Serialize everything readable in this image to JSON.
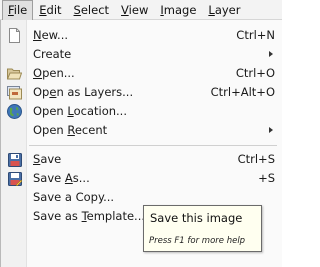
{
  "menubar": {
    "items": [
      {
        "id": "file",
        "label": "File",
        "mnemonic": "F",
        "rest": "ile"
      },
      {
        "id": "edit",
        "label": "Edit",
        "mnemonic": "E",
        "rest": "dit"
      },
      {
        "id": "select",
        "label": "Select",
        "mnemonic": "S",
        "rest": "elect"
      },
      {
        "id": "view",
        "label": "View",
        "mnemonic": "V",
        "rest": "iew"
      },
      {
        "id": "image",
        "label": "Image",
        "mnemonic": "I",
        "rest": "mage"
      },
      {
        "id": "layer",
        "label": "Layer",
        "mnemonic": "L",
        "rest": "ayer"
      }
    ],
    "active": "File"
  },
  "file_menu": {
    "new": {
      "label": "New...",
      "pre": "",
      "mn": "N",
      "post": "ew...",
      "shortcut": "Ctrl+N",
      "icon": "new-document-icon"
    },
    "create": {
      "label": "Create",
      "has_submenu": true
    },
    "open": {
      "label": "Open...",
      "pre": "",
      "mn": "O",
      "post": "pen...",
      "shortcut": "Ctrl+O",
      "icon": "folder-open-icon"
    },
    "open_as_layers": {
      "label": "Open as Layers...",
      "pre": "Op",
      "mn": "e",
      "post": "n as Layers...",
      "shortcut": "Ctrl+Alt+O",
      "icon": "open-as-layers-icon"
    },
    "open_location": {
      "label": "Open Location...",
      "pre": "Open ",
      "mn": "L",
      "post": "ocation...",
      "icon": "globe-icon"
    },
    "open_recent": {
      "label": "Open Recent",
      "pre": "Open ",
      "mn": "R",
      "post": "ecent",
      "has_submenu": true
    },
    "save": {
      "label": "Save",
      "pre": "",
      "mn": "S",
      "post": "ave",
      "shortcut": "Ctrl+S",
      "icon": "save-icon"
    },
    "save_as": {
      "label": "Save As...",
      "pre": "Save ",
      "mn": "A",
      "post": "s...",
      "shortcut": "Shift+Ctrl+S",
      "shortcut_visible": "+S",
      "icon": "save-as-icon"
    },
    "save_copy": {
      "label": "Save a Copy..."
    },
    "save_template": {
      "label": "Save as Template...",
      "pre": "Save as ",
      "mn": "T",
      "post": "emplate..."
    }
  },
  "tooltip": {
    "title": "Save this image",
    "hint": "Press F1 for more help"
  },
  "colors": {
    "menubar_bg": "#f3f3f3",
    "menu_bg": "#fafafa",
    "tooltip_bg": "#fffff0",
    "hover_bg": "#e4e8ee"
  }
}
